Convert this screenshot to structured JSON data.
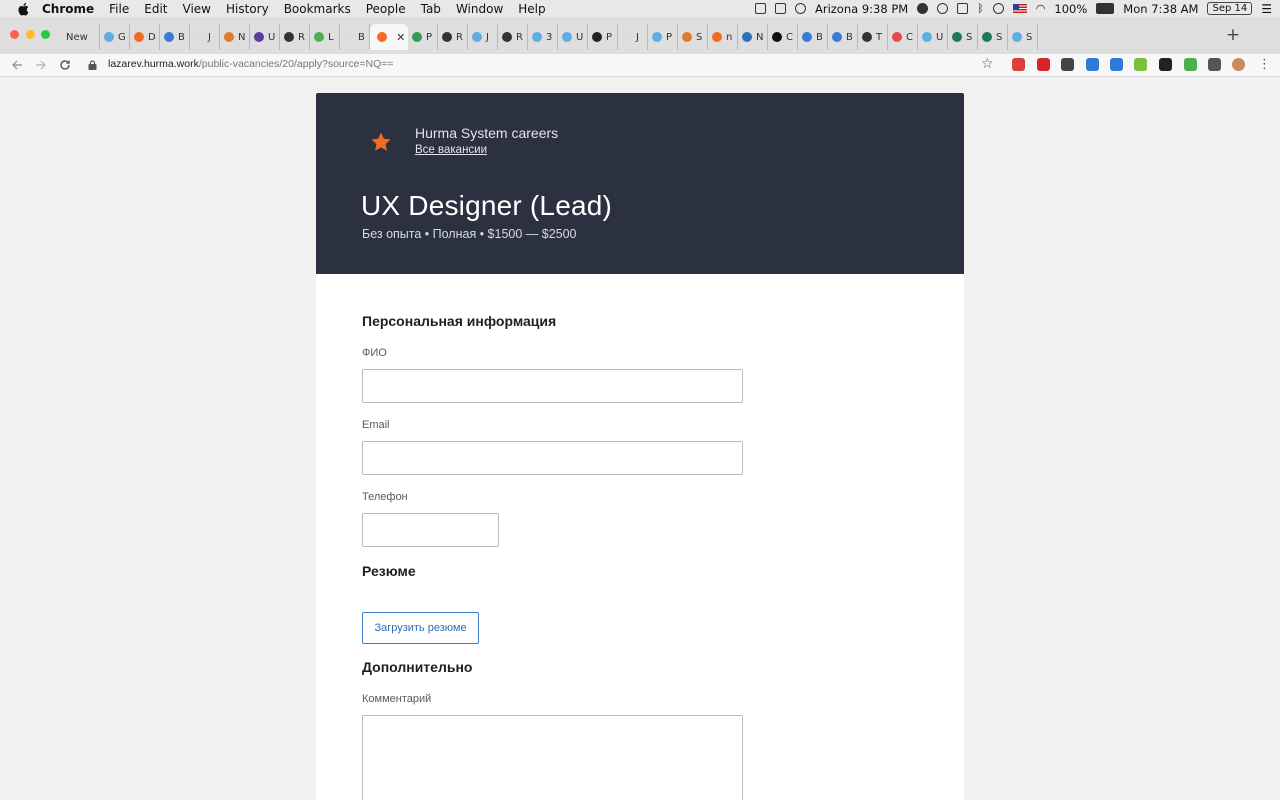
{
  "menubar": {
    "app_name": "Chrome",
    "items": [
      "File",
      "Edit",
      "View",
      "History",
      "Bookmarks",
      "People",
      "Tab",
      "Window",
      "Help"
    ],
    "status": {
      "location_time": "Arizona 9:38 PM",
      "battery": "100%",
      "clock": "Mon 7:38 AM",
      "date": "Sep 14"
    }
  },
  "tabs": [
    {
      "label": "New",
      "icon": "blank-icon",
      "color": "#cccccc"
    },
    {
      "label": "G",
      "icon": "eye-icon",
      "color": "#5aaee0"
    },
    {
      "label": "D",
      "icon": "hurma-icon",
      "color": "#f26b22"
    },
    {
      "label": "B",
      "icon": "loading-icon",
      "color": "#3b79d4"
    },
    {
      "label": "J",
      "icon": "blank-icon",
      "color": "#dddddd"
    },
    {
      "label": "N",
      "icon": "c-icon",
      "color": "#e07a2d"
    },
    {
      "label": "U",
      "icon": "doc-icon",
      "color": "#5b3fa0"
    },
    {
      "label": "R",
      "icon": "edit-icon",
      "color": "#333333"
    },
    {
      "label": "L",
      "icon": "w-icon",
      "color": "#4caf50"
    },
    {
      "label": "B",
      "icon": "blank-icon",
      "color": "#dddddd"
    },
    {
      "label": "",
      "icon": "hurma-icon",
      "color": "#f26b22",
      "active": true
    },
    {
      "label": "P",
      "icon": "dollar-icon",
      "color": "#2e9e57"
    },
    {
      "label": "R",
      "icon": "edit-icon",
      "color": "#333333"
    },
    {
      "label": "J",
      "icon": "eye-icon",
      "color": "#5aaee0"
    },
    {
      "label": "R",
      "icon": "edit-icon",
      "color": "#333333"
    },
    {
      "label": "3",
      "icon": "eye-icon",
      "color": "#5aaee0"
    },
    {
      "label": "U",
      "icon": "eye-icon",
      "color": "#5aaee0"
    },
    {
      "label": "P",
      "icon": "wix-icon",
      "color": "#222222"
    },
    {
      "label": "J",
      "icon": "blank-icon",
      "color": "#dddddd"
    },
    {
      "label": "P",
      "icon": "eye-icon",
      "color": "#5aaee0"
    },
    {
      "label": "S",
      "icon": "c-icon",
      "color": "#e07a2d"
    },
    {
      "label": "n",
      "icon": "hurma-icon",
      "color": "#f26b22"
    },
    {
      "label": "N",
      "icon": "arc-icon",
      "color": "#2d6fb8"
    },
    {
      "label": "C",
      "icon": "b-icon",
      "color": "#111111"
    },
    {
      "label": "B",
      "icon": "loading-icon",
      "color": "#3b79d4"
    },
    {
      "label": "B",
      "icon": "loading-icon",
      "color": "#3b79d4"
    },
    {
      "label": "T",
      "icon": "edit-icon",
      "color": "#333333"
    },
    {
      "label": "C",
      "icon": "oval-icon",
      "color": "#e34b4b"
    },
    {
      "label": "U",
      "icon": "eye-icon",
      "color": "#5aaee0"
    },
    {
      "label": "S",
      "icon": "upwork-icon",
      "color": "#1b7a55"
    },
    {
      "label": "S",
      "icon": "upwork-icon",
      "color": "#1b7a55"
    },
    {
      "label": "S",
      "icon": "eye-icon",
      "color": "#5aaee0"
    }
  ],
  "active_tab_close": "✕",
  "new_tab": "+",
  "address": {
    "host": "lazarev.hurma.work",
    "path": "/public-vacancies/20/apply?source=NQ=="
  },
  "extensions": [
    {
      "name": "flag-icon",
      "color": "#d9413b"
    },
    {
      "name": "opera-icon",
      "color": "#d8232a"
    },
    {
      "name": "mail-icon",
      "color": "#444444"
    },
    {
      "name": "puzzle-icon",
      "color": "#2f7ad6"
    },
    {
      "name": "puzzle-icon",
      "color": "#2f7ad6"
    },
    {
      "name": "pencil-icon",
      "color": "#7cbf3f"
    },
    {
      "name": "badge-icon",
      "color": "#222222"
    },
    {
      "name": "plus-icon",
      "color": "#4caf50"
    },
    {
      "name": "extensions-icon",
      "color": "#555555"
    },
    {
      "name": "profile-avatar-icon",
      "color": "#c98a5a"
    }
  ],
  "header": {
    "company_name": "Hurma System careers",
    "all_vacancies_link": "Все вакансии",
    "job_title": "UX Designer (Lead)",
    "job_meta": "Без опыта • Полная • $1500 — $2500",
    "logo_color": "#f26b22"
  },
  "form": {
    "personal_heading": "Персональная информация",
    "full_name_label": "ФИО",
    "full_name_value": "",
    "email_label": "Email",
    "email_value": "",
    "phone_label": "Телефон",
    "phone_value": "",
    "resume_heading": "Резюме",
    "upload_button": "Загрузить резюме",
    "additional_heading": "Дополнительно",
    "comment_label": "Комментарий",
    "comment_value": ""
  }
}
